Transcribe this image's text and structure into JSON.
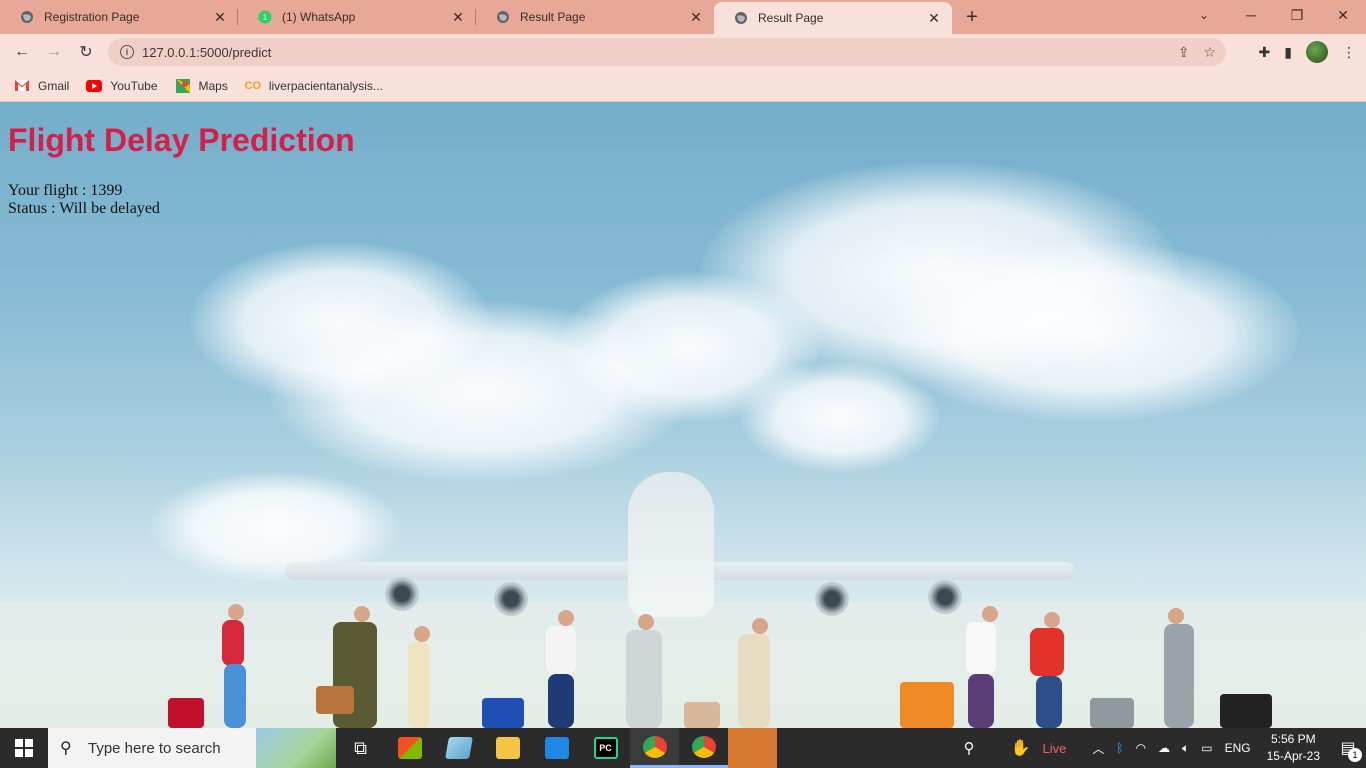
{
  "browser": {
    "tabs": [
      {
        "title": "Registration Page",
        "icon": "globe-icon",
        "active": false
      },
      {
        "title": "(1) WhatsApp",
        "icon": "whatsapp-icon",
        "active": false
      },
      {
        "title": "Result Page",
        "icon": "globe-icon",
        "active": false
      },
      {
        "title": "Result Page",
        "icon": "globe-icon",
        "active": true
      }
    ],
    "url": "127.0.0.1:5000/predict",
    "bookmarks": [
      {
        "label": "Gmail",
        "icon": "gmail-icon"
      },
      {
        "label": "YouTube",
        "icon": "youtube-icon"
      },
      {
        "label": "Maps",
        "icon": "maps-icon"
      },
      {
        "label": "liverpacientanalysis...",
        "icon": "co-icon"
      }
    ]
  },
  "page": {
    "heading": "Flight Delay Prediction",
    "flight_line": "Your flight : 1399",
    "status_line": "Status : Will be delayed"
  },
  "taskbar": {
    "search_placeholder": "Type here to search",
    "live_label": "Live",
    "language": "ENG",
    "time": "5:56 PM",
    "date": "15-Apr-23",
    "notification_count": "1"
  }
}
